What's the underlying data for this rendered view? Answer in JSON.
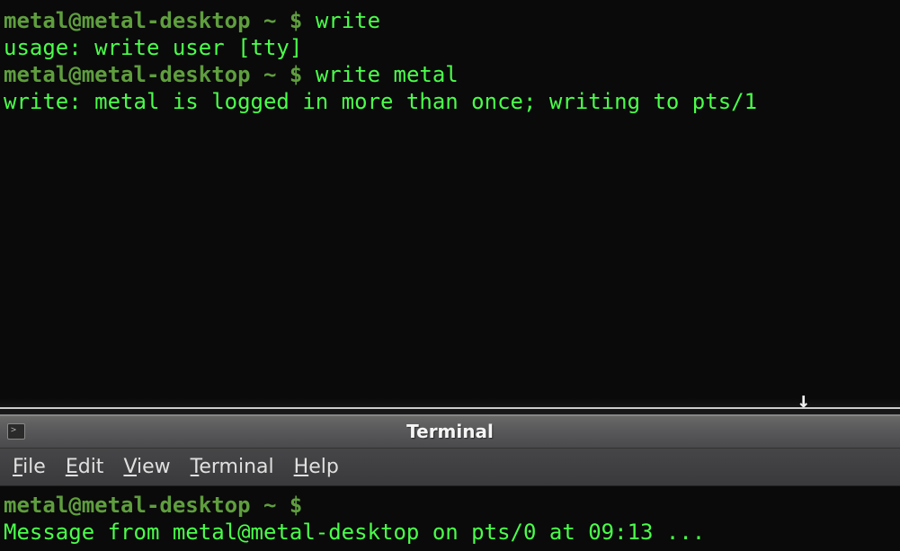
{
  "top_terminal": {
    "lines": [
      {
        "prompt_user": "metal@metal-desktop",
        "prompt_path": "~",
        "prompt_symbol": "$",
        "command": "write"
      },
      {
        "output": "usage: write user [tty]"
      },
      {
        "prompt_user": "metal@metal-desktop",
        "prompt_path": "~",
        "prompt_symbol": "$",
        "command": "write metal"
      },
      {
        "output": "write: metal is logged in more than once; writing to pts/1"
      }
    ]
  },
  "window": {
    "title": "Terminal",
    "menu": {
      "file": "File",
      "edit": "Edit",
      "view": "View",
      "terminal": "Terminal",
      "help": "Help"
    }
  },
  "bottom_terminal": {
    "lines": [
      {
        "prompt_user": "metal@metal-desktop",
        "prompt_path": "~",
        "prompt_symbol": "$",
        "command": ""
      },
      {
        "output": "Message from metal@metal-desktop on pts/0 at 09:13 ..."
      }
    ]
  }
}
